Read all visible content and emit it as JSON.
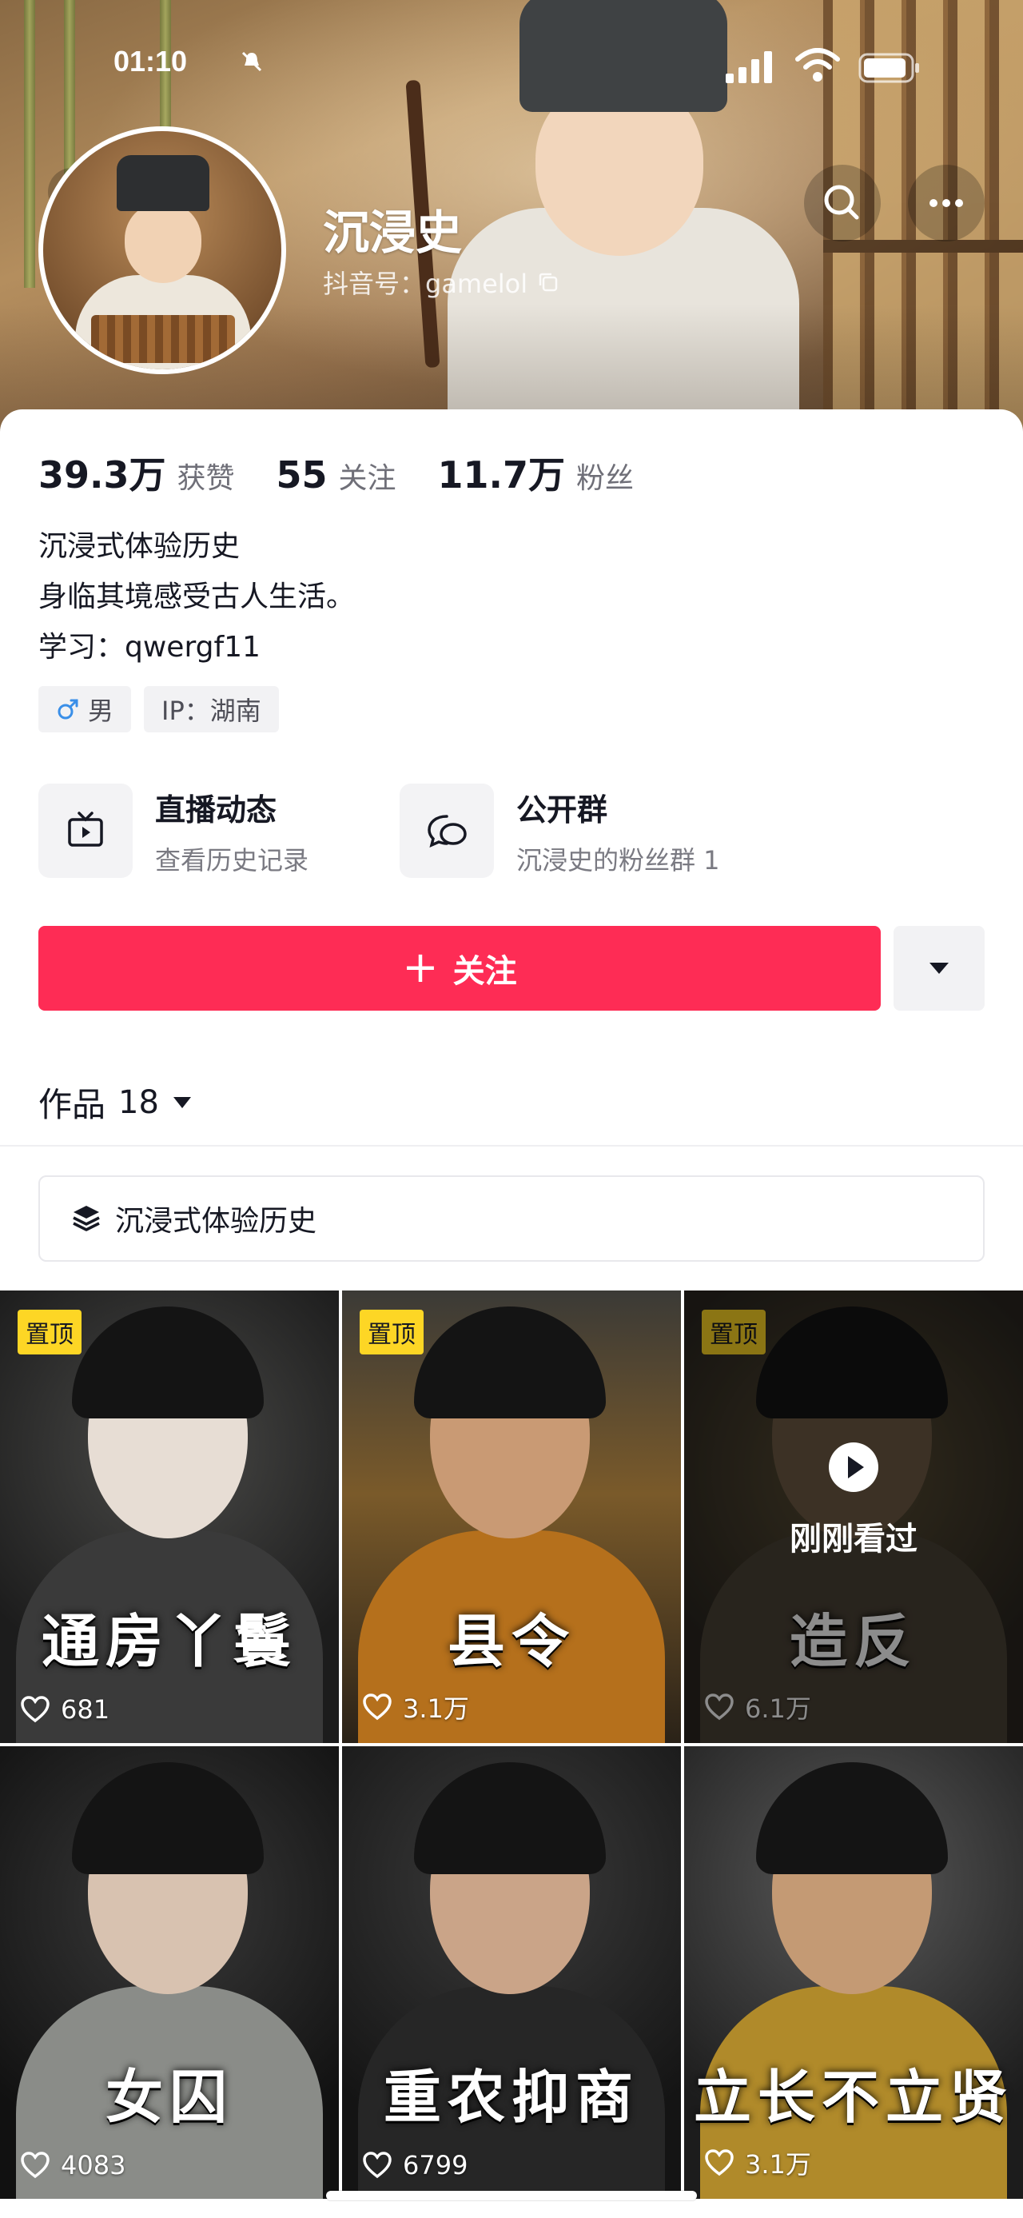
{
  "status_bar": {
    "time": "01:10"
  },
  "profile": {
    "name": "沉浸史",
    "douyin_id": "抖音号：gamelol"
  },
  "stats": [
    {
      "value": "39.3万",
      "label": "获赞"
    },
    {
      "value": "55",
      "label": "关注"
    },
    {
      "value": "11.7万",
      "label": "粉丝"
    }
  ],
  "bio": {
    "line1": "沉浸式体验历史",
    "line2": "身临其境感受古人生活。",
    "line3": "学习：qwergf11"
  },
  "tags": {
    "gender": "男",
    "ip": "IP：湖南"
  },
  "quick_links": [
    {
      "title": "直播动态",
      "subtitle": "查看历史记录",
      "icon": "tv-icon"
    },
    {
      "title": "公开群",
      "subtitle": "沉浸史的粉丝群 1",
      "icon": "chat-bubbles-icon"
    }
  ],
  "actions": {
    "follow_label": "关注",
    "follow_plus": "+"
  },
  "works": {
    "label": "作品",
    "count": "18"
  },
  "collection": {
    "label": "沉浸式体验历史"
  },
  "videos": [
    {
      "title": "通房丫鬟",
      "likes": "681",
      "pinned": true,
      "pin_label": "置顶",
      "watched": false
    },
    {
      "title": "县令",
      "likes": "3.1万",
      "pinned": true,
      "pin_label": "置顶",
      "watched": false
    },
    {
      "title": "造反",
      "likes": "6.1万",
      "pinned": true,
      "pin_label": "置顶",
      "watched": true,
      "watched_label": "刚刚看过"
    },
    {
      "title": "女囚",
      "likes": "4083",
      "pinned": false
    },
    {
      "title": "重农抑商",
      "likes": "6799",
      "pinned": false
    },
    {
      "title": "立长不立贤",
      "likes": "3.1万",
      "pinned": false
    }
  ],
  "colors": {
    "accent": "#fe2c55",
    "pin": "#fdd625",
    "text": "#161823",
    "muted": "#6f6f78"
  }
}
